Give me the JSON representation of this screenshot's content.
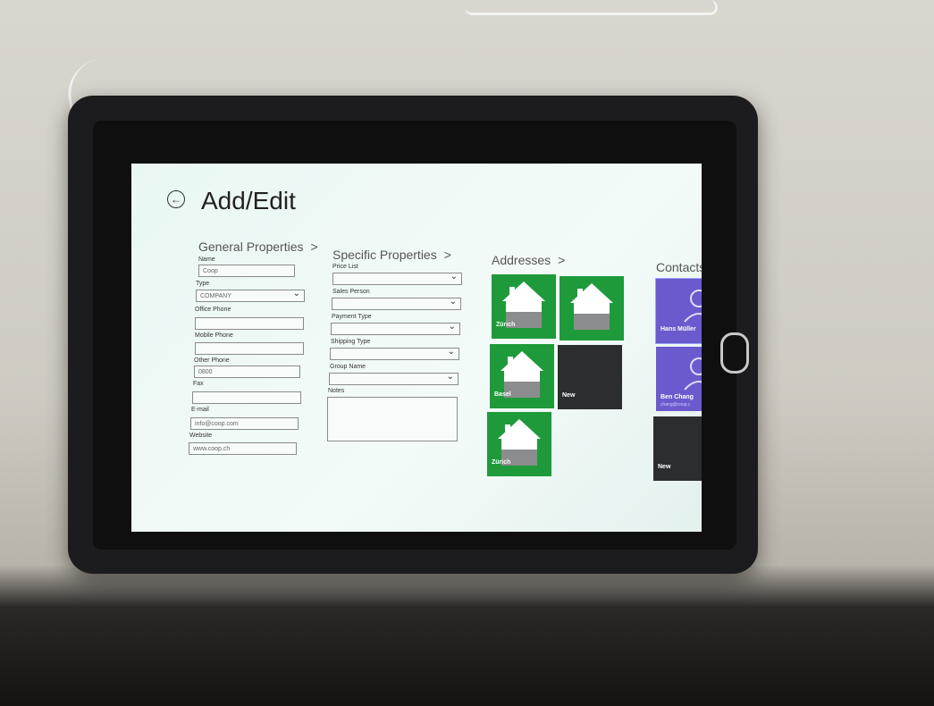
{
  "page": {
    "title": "Add/Edit"
  },
  "sections": {
    "general": "General Properties",
    "specific": "Specific Properties",
    "addresses": "Addresses",
    "contacts": "Contacts",
    "chevron": ">"
  },
  "general": {
    "name_label": "Name",
    "name_value": "Coop",
    "type_label": "Type",
    "type_value": "COMPANY",
    "office_label": "Office Phone",
    "office_value": "",
    "mobile_label": "Mobile Phone",
    "mobile_value": "",
    "other_label": "Other Phone",
    "other_value": "0800",
    "fax_label": "Fax",
    "fax_value": "",
    "email_label": "E-mail",
    "email_value": "info@coop.com",
    "website_label": "Website",
    "website_value": "www.coop.ch"
  },
  "specific": {
    "price_label": "Price List",
    "sales_label": "Sales Person",
    "payment_label": "Payment Type",
    "shipping_label": "Shipping Type",
    "group_label": "Group Name",
    "notes_label": "Notes"
  },
  "addresses": [
    {
      "label": "Zürich"
    },
    {
      "label": ""
    },
    {
      "label": "Basel"
    },
    {
      "label": "New"
    },
    {
      "label": "Zürich"
    }
  ],
  "contacts": [
    {
      "name": "Hans Müller",
      "sub": ""
    },
    {
      "name": "Ben Chang",
      "sub": "chang@coop.c"
    },
    {
      "name": "New",
      "sub": ""
    }
  ],
  "colors": {
    "tile_green": "#1f9a3b",
    "tile_dark": "#2b2d2f",
    "tile_purple": "#6a5acd"
  }
}
